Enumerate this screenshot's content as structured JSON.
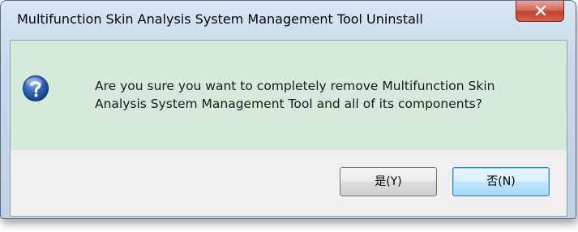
{
  "window": {
    "title": "Multifunction Skin Analysis System Management Tool Uninstall"
  },
  "dialog": {
    "icon": "question-icon",
    "message": "Are you sure you want to completely remove Multifunction Skin Analysis System Management Tool and all of its components?"
  },
  "buttons": {
    "yes_label": "是(Y)",
    "no_label": "否(N)"
  },
  "colors": {
    "content_background": "#d5eadb",
    "close_button": "#c2402f",
    "focused_button_border": "#3c7fb1"
  }
}
